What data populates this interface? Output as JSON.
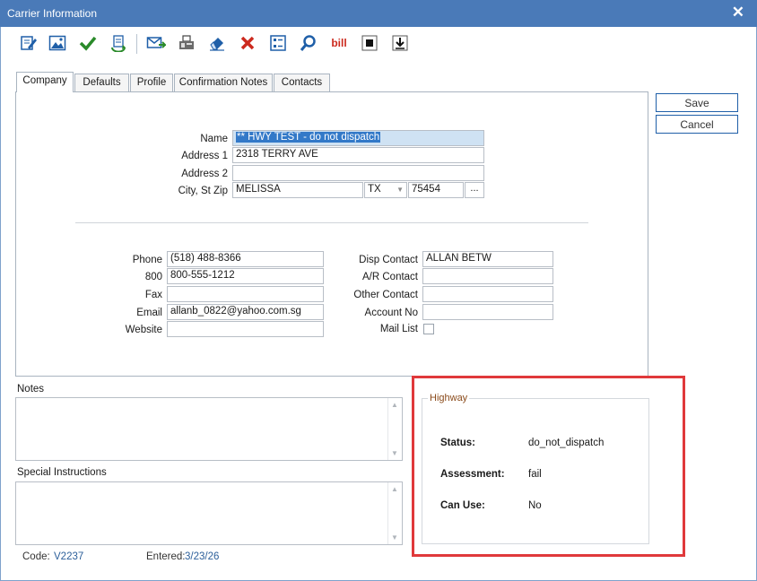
{
  "window": {
    "title": "Carrier Information",
    "close_glyph": "✕"
  },
  "toolbar": {
    "icons": [
      "edit-icon",
      "image-icon",
      "checkmark-icon",
      "refresh-docs-icon",
      "email-send-icon",
      "fax-icon",
      "eraser-icon",
      "delete-x-icon",
      "checklist-icon",
      "search-icon",
      "bill-icon",
      "stop-icon",
      "download-icon"
    ],
    "bill_label": "bill",
    "colors": {
      "blue": "#1f5fa8",
      "green": "#2a8a2a",
      "red": "#cc2a1e"
    }
  },
  "tabs": [
    "Company",
    "Defaults",
    "Profile",
    "Confirmation Notes",
    "Contacts"
  ],
  "buttons": {
    "save": "Save",
    "cancel": "Cancel"
  },
  "company": {
    "name_label": "Name",
    "name_value": "** HWY TEST - do not dispatch",
    "address1_label": "Address 1",
    "address1_value": "2318 TERRY AVE",
    "address2_label": "Address 2",
    "address2_value": "",
    "city_label": "City, St Zip",
    "city_value": "MELISSA",
    "state_value": "TX",
    "zip_value": "75454",
    "lookup_label": "...",
    "phone_label": "Phone",
    "phone_value": "(518) 488-8366",
    "tollfree_label": "800",
    "tollfree_value": "800-555-1212",
    "fax_label": "Fax",
    "fax_value": "",
    "email_label": "Email",
    "email_value": "allanb_0822@yahoo.com.sg",
    "website_label": "Website",
    "website_value": "",
    "disp_contact_label": "Disp Contact",
    "disp_contact_value": "ALLAN BETW",
    "ar_contact_label": "A/R Contact",
    "ar_contact_value": "",
    "other_contact_label": "Other Contact",
    "other_contact_value": "",
    "account_no_label": "Account No",
    "account_no_value": "",
    "mail_list_label": "Mail List"
  },
  "notes": {
    "label": "Notes",
    "value": ""
  },
  "special": {
    "label": "Special Instructions",
    "value": ""
  },
  "footer": {
    "code_label": "Code:",
    "code_value": "V2237",
    "entered_label": "Entered:",
    "entered_value": "3/23/26"
  },
  "highway": {
    "title": "Highway",
    "status_label": "Status:",
    "status_value": "do_not_dispatch",
    "assessment_label": "Assessment:",
    "assessment_value": "fail",
    "can_use_label": "Can Use:",
    "can_use_value": "No",
    "highlight_color": "#e0393b"
  }
}
